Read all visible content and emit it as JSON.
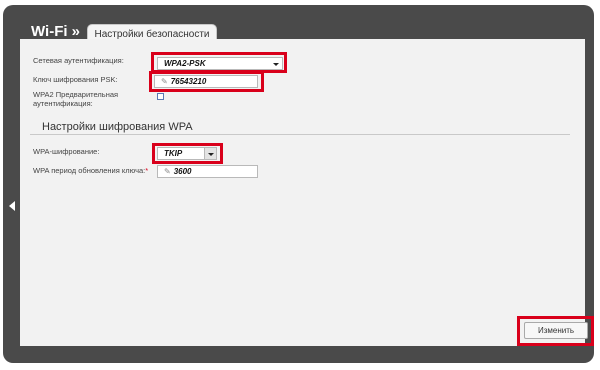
{
  "header": {
    "title": "Wi-Fi »",
    "tab_label": "Настройки безопасности"
  },
  "form": {
    "auth_label": "Сетевая аутентификация:",
    "auth_value": "WPA2-PSK",
    "psk_label": "Ключ шифрования PSK:",
    "psk_value": "76543210",
    "preauth_label": "WPA2 Предварительная аутентификация:",
    "preauth_checked": false,
    "section_title": "Настройки шифрования WPA",
    "cipher_label": "WPA-шифрование:",
    "cipher_value": "TKIP",
    "period_label": "WPA период обновления ключа:",
    "required_mark": "*",
    "period_value": "3600"
  },
  "actions": {
    "apply_label": "Изменить"
  },
  "colors": {
    "highlight": "#d9001b",
    "frame": "#4a4a4a",
    "panel": "#f2f2f2"
  }
}
